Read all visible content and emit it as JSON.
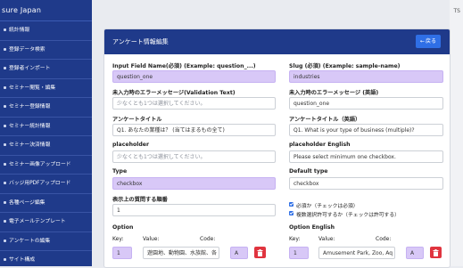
{
  "sidebar": {
    "brand": "sure Japan",
    "items": [
      {
        "label": "統計情報"
      },
      {
        "label": "登録データ検索"
      },
      {
        "label": "登録者インポート"
      },
      {
        "label": "セミナー閲覧・編集"
      },
      {
        "label": "セミナー登録情報"
      },
      {
        "label": "セミナー統計情報"
      },
      {
        "label": "セミナー決済情報"
      },
      {
        "label": "セミナー画像アップロード"
      },
      {
        "label": "バッジ用PDFアップロード"
      },
      {
        "label": "各種ページ編集"
      },
      {
        "label": "電子メールテンプレート"
      },
      {
        "label": "アンケートの編集"
      },
      {
        "label": "サイト構成"
      }
    ]
  },
  "topright": {
    "label": "TS"
  },
  "card": {
    "title": "アンケート情報編集",
    "back_label": "戻る"
  },
  "form": {
    "input_name": {
      "label": "Input Field Name(必須) (Example: question_...)",
      "value": "question_one"
    },
    "slug": {
      "label": "Slug (必須) (Example: sample-name)",
      "value": "industries"
    },
    "error_msg": {
      "label": "未入力時のエラーメッセージ(Validation Text)",
      "placeholder": "少なくとも1つは選択してください。"
    },
    "error_msg_en": {
      "label": "未入力時のエラーメッセージ (英語)",
      "value": "question_one"
    },
    "title": {
      "label": "アンケートタイトル",
      "value": "Q1. あなたの業種は？ (当てはまるもの全て)"
    },
    "title_en": {
      "label": "アンケートタイトル（英語）",
      "value": "Q1. What is your type of business (multiple)?"
    },
    "placeholder": {
      "label": "placeholder",
      "placeholder": "少なくとも1つは選択してください。"
    },
    "placeholder_en": {
      "label": "placeholder English",
      "value": "Please select minimum one checkbox."
    },
    "type": {
      "label": "Type",
      "value": "checkbox"
    },
    "default_type": {
      "label": "Default type",
      "value": "checkbox"
    },
    "display_order": {
      "label": "表示上の質問する順番",
      "value": "1"
    },
    "required_check": {
      "label": "必須か（チェックは必須）",
      "checked": true
    },
    "multiple_check": {
      "label": "複数選択許可するか（チェックは許可する）",
      "checked": true
    },
    "option": {
      "label": "Option",
      "key_label": "Key:",
      "value_label": "Value:",
      "code_label": "Code:",
      "row": {
        "key": "1",
        "value": "遊園地、動物園、水族館、各",
        "code": "A"
      }
    },
    "option_en": {
      "label": "Option English",
      "key_label": "Key:",
      "value_label": "Value:",
      "code_label": "Code:",
      "row": {
        "key": "1",
        "value": "Amusement Park, Zoo, Aq",
        "code": "A"
      }
    }
  },
  "colors": {
    "sidebar": "#1f3a8a",
    "accent": "#2f6fe6",
    "highlight": "#d8c8f7",
    "danger": "#e0343f"
  }
}
